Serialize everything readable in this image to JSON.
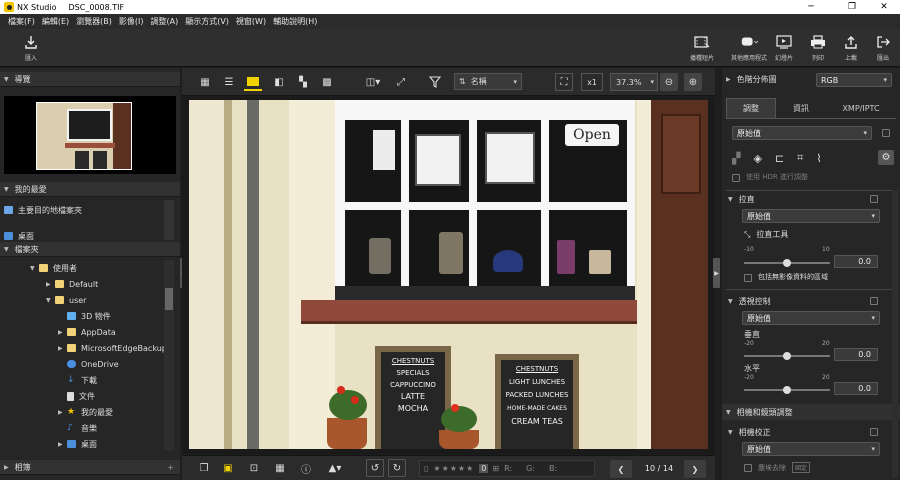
{
  "titlebar": {
    "app": "NX Studio",
    "file": "DSC_0008.TIF",
    "minimize": "─",
    "maximize": "❐",
    "close": "✕"
  },
  "menu": [
    "檔案(F)",
    "編輯(E)",
    "瀏覽器(B)",
    "影像(I)",
    "調整(A)",
    "顯示方式(V)",
    "視窗(W)",
    "輔助說明(H)"
  ],
  "toolbar": {
    "import": "匯入",
    "edit_movie": "播種短片",
    "other_apps": "其他應用程式",
    "slideshow": "幻燈片",
    "print": "列印",
    "upload": "上載",
    "export": "匯出"
  },
  "left": {
    "navigator": "導覽",
    "favorites": "我的最愛",
    "fav_items": [
      "主要目的地檔案夾",
      "桌面"
    ],
    "folders": "檔案夾",
    "tree": [
      "使用者",
      "Default",
      "user",
      "3D 物件",
      "AppData",
      "MicrosoftEdgeBackups",
      "OneDrive",
      "下載",
      "文件",
      "我的最愛",
      "音樂",
      "桌面"
    ],
    "album": "相簿"
  },
  "center": {
    "sort_label": "名稱",
    "x1": "x1",
    "zoom": "37.3%",
    "page": "10 / 14",
    "rgb": [
      "R:",
      "G:",
      "B:"
    ],
    "rating_zero": "0"
  },
  "photo": {
    "sign_open": "Open",
    "board1": [
      "CHESTNUTS",
      "SPECIALS",
      "CAPPUCCINO",
      "LATTE",
      "MOCHA"
    ],
    "board2": [
      "CHESTNUTS",
      "LIGHT LUNCHES",
      "PACKED LUNCHES",
      "HOME-MADE CAKES",
      "CREAM TEAS"
    ]
  },
  "right": {
    "histogram": "色階分佈圖",
    "histo_mode": "RGB",
    "tabs": [
      "調整",
      "資訊",
      "XMP/IPTC"
    ],
    "preset": "原始值",
    "hdr": "使用 HDR 進行調整",
    "straighten": "拉直",
    "straighten_val": "原始值",
    "straighten_tool": "拉直工具",
    "s_min": "-10",
    "s_max": "10",
    "s_num": "0.0",
    "include_blank": "包括無影像資料的區域",
    "perspective": "透視控制",
    "persp_val": "原始值",
    "vertical": "垂直",
    "horizontal": "水平",
    "p_min": "-20",
    "p_max": "20",
    "v_num": "0.0",
    "h_num": "0.0",
    "camera_lens": "相機和鏡頭調整",
    "camera_correct": "相機校正",
    "cam_val": "原始值",
    "dust": "塵埃去除",
    "fixed": "固定"
  }
}
